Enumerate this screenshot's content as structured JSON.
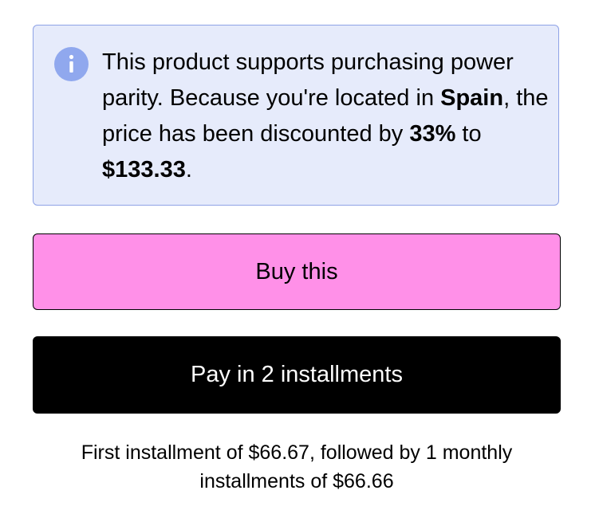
{
  "notice": {
    "icon": "info-icon",
    "text_1": "This product supports purchasing power parity. Because you're located in ",
    "country": "Spain",
    "text_2": ", the price has been discounted by ",
    "discount": "33%",
    "text_3": " to ",
    "price": "$133.33",
    "text_4": ".",
    "colors": {
      "background": "#e6ebfb",
      "border": "#8ea2e6",
      "icon": "#90a8ee"
    }
  },
  "buttons": {
    "buy_label": "Buy this",
    "buy_color": "#ff90e8",
    "installments_label": "Pay in 2 installments",
    "installments_color": "#000000"
  },
  "installment_note": "First installment of $66.67, followed by 1 monthly installments of $66.66"
}
